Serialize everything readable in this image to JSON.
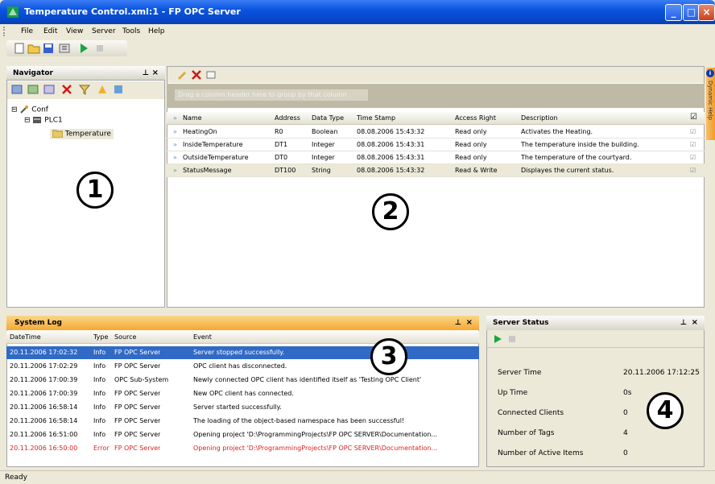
{
  "window": {
    "title": "Temperature Control.xml:1 - FP OPC Server"
  },
  "menu": [
    "File",
    "Edit",
    "View",
    "Server",
    "Tools",
    "Help"
  ],
  "navigator": {
    "title": "Navigator",
    "tree": {
      "root": "Conf",
      "plc": "PLC1",
      "folder": "Temperature"
    }
  },
  "grid": {
    "group_hint": "Drag a column header here to group by that column",
    "columns": [
      "Name",
      "Address",
      "Data Type",
      "Time Stamp",
      "Access Right",
      "Description"
    ],
    "rows": [
      {
        "name": "HeatingOn",
        "address": "R0",
        "type": "Boolean",
        "time": "08.08.2006 15:43:32",
        "access": "Read only",
        "desc": "Activates the Heating."
      },
      {
        "name": "InsideTemperature",
        "address": "DT1",
        "type": "Integer",
        "time": "08.08.2006 15:43:31",
        "access": "Read only",
        "desc": "The temperature inside the building."
      },
      {
        "name": "OutsideTemperature",
        "address": "DT0",
        "type": "Integer",
        "time": "08.08.2006 15:43:31",
        "access": "Read only",
        "desc": "The temperature of the courtyard."
      },
      {
        "name": "StatusMessage",
        "address": "DT100",
        "type": "String",
        "time": "08.08.2006 15:43:32",
        "access": "Read & Write",
        "desc": "Displayes the current status."
      }
    ]
  },
  "syslog": {
    "title": "System Log",
    "columns": [
      "DateTime",
      "Type",
      "Source",
      "Event"
    ],
    "rows": [
      {
        "dt": "20.11.2006 17:02:32",
        "type": "Info",
        "source": "FP OPC Server",
        "event": "Server stopped successfully."
      },
      {
        "dt": "20.11.2006 17:02:29",
        "type": "Info",
        "source": "FP OPC Server",
        "event": "OPC client has disconnected."
      },
      {
        "dt": "20.11.2006 17:00:39",
        "type": "Info",
        "source": "OPC Sub-System",
        "event": "Newly connected OPC client has identified itself as 'Testing OPC Client'"
      },
      {
        "dt": "20.11.2006 17:00:39",
        "type": "Info",
        "source": "FP OPC Server",
        "event": "New OPC client has connected."
      },
      {
        "dt": "20.11.2006 16:58:14",
        "type": "Info",
        "source": "FP OPC Server",
        "event": "Server started successfully."
      },
      {
        "dt": "20.11.2006 16:58:14",
        "type": "Info",
        "source": "FP OPC Server",
        "event": "The loading of the object-based namespace has been successful!"
      },
      {
        "dt": "20.11.2006 16:51:00",
        "type": "Info",
        "source": "FP OPC Server",
        "event": "Opening project 'D:\\ProgrammingProjects\\FP OPC SERVER\\Documentation..."
      },
      {
        "dt": "20.11.2006 16:50:00",
        "type": "Error",
        "source": "FP OPC Server",
        "event": "Opening project 'D:\\ProgrammingProjects\\FP OPC SERVER\\Documentation..."
      }
    ]
  },
  "server_status": {
    "title": "Server Status",
    "items": [
      {
        "label": "Server Time",
        "value": "20.11.2006 17:12:25"
      },
      {
        "label": "Up Time",
        "value": "0s"
      },
      {
        "label": "Connected Clients",
        "value": "0"
      },
      {
        "label": "Number of Tags",
        "value": "4"
      },
      {
        "label": "Number of Active Items",
        "value": "0"
      }
    ]
  },
  "callouts": [
    "1",
    "2",
    "3",
    "4"
  ],
  "right_tab": "Dynamic Help",
  "statusbar": "Ready",
  "colors": {
    "titlebar": "#0a55e0",
    "selection": "#316ac5",
    "error": "#e02020",
    "log_header": "#f5a734"
  }
}
